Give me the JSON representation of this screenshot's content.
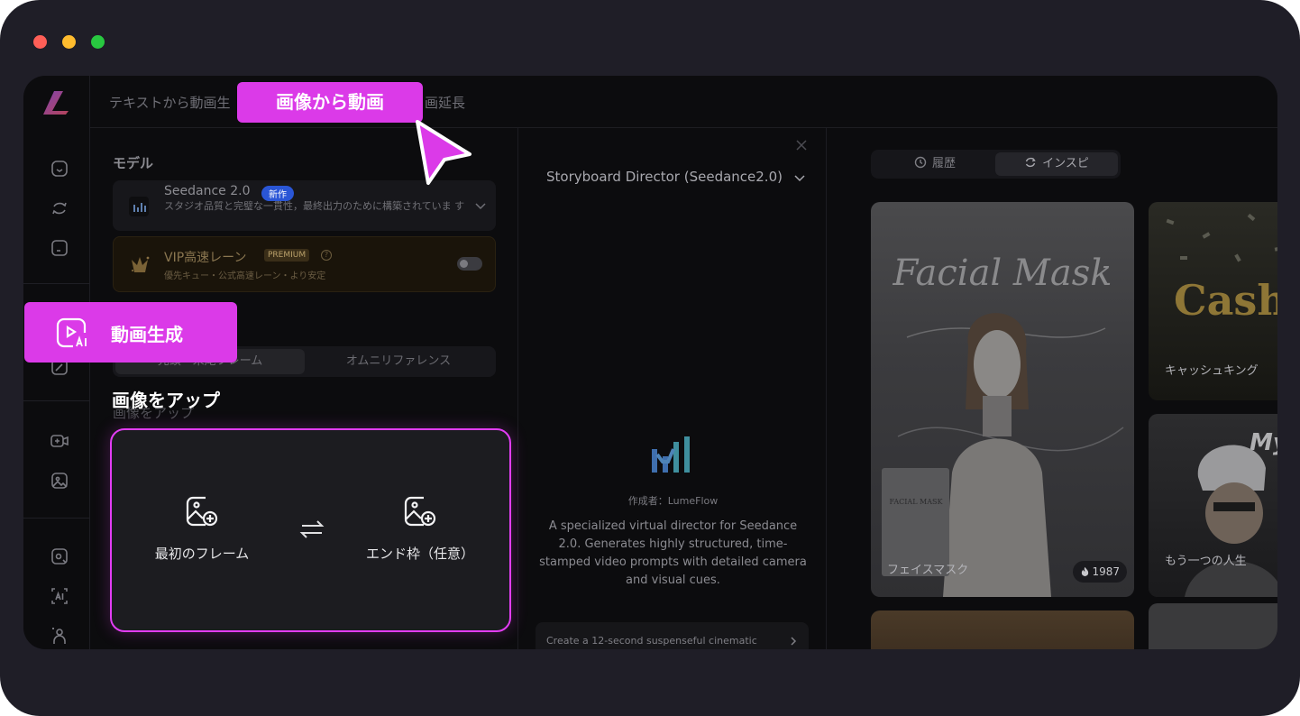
{
  "window": {
    "traffic_lights": [
      "close",
      "minimize",
      "zoom"
    ]
  },
  "topbar": {
    "tab_text_to_video": "テキストから動画生",
    "tab_extend": "画延長"
  },
  "highlight_tab_label": "画像から動画",
  "highlight_nav_label": "動画生成",
  "sidebar": {
    "icons": [
      "home-icon",
      "refresh-icon",
      "folder-icon",
      "edit-image-icon",
      "video-add-icon",
      "image-icon",
      "photo-edit-icon",
      "ai-text-icon",
      "avatar-icon"
    ]
  },
  "settings": {
    "model_section": "モデル",
    "model": {
      "name": "Seedance 2.0",
      "badge": "新作",
      "description": "スタジオ品質と完璧な一貫性，最終出力のために構築されていま す"
    },
    "vip": {
      "name": "VIP高速レーン",
      "badge": "PREMIUM",
      "help": "?",
      "description": "優先キュー・公式高速レーン・より安定"
    },
    "mode_tabs": {
      "first_last": "先頭・末尾フレーム",
      "omni": "オムニリファレンス"
    },
    "upload_title": "画像をアップ",
    "upload_ghost": "画像をアップ",
    "first_frame": "最初のフレーム",
    "end_frame": "エンド枠（任意）"
  },
  "agent": {
    "title": "Storyboard Director (Seedance2.0)",
    "author": "作成者：LumeFlow",
    "description": "A specialized virtual director for Seedance 2.0. Generates highly structured, time-stamped video prompts with detailed camera and visual cues.",
    "prompt": "Create a 12-second suspenseful cinematic"
  },
  "gallery": {
    "tabs": {
      "history": "履歴",
      "inspiration": "インスピ"
    },
    "cards": [
      {
        "overlay_title": "Facial Mask",
        "label": "フェイスマスク",
        "likes": "1987",
        "product_text": "FACIAL MASK"
      },
      {
        "overlay_title": "Cash",
        "label": "キャッシュキング"
      },
      {
        "overlay_title": "My",
        "label": "もう一つの人生"
      }
    ]
  },
  "colors": {
    "highlight": "#db3ae8",
    "upload_border": "#e23df4",
    "app_bg": "#0c0c0e",
    "frame_bg": "#1f1e27"
  }
}
